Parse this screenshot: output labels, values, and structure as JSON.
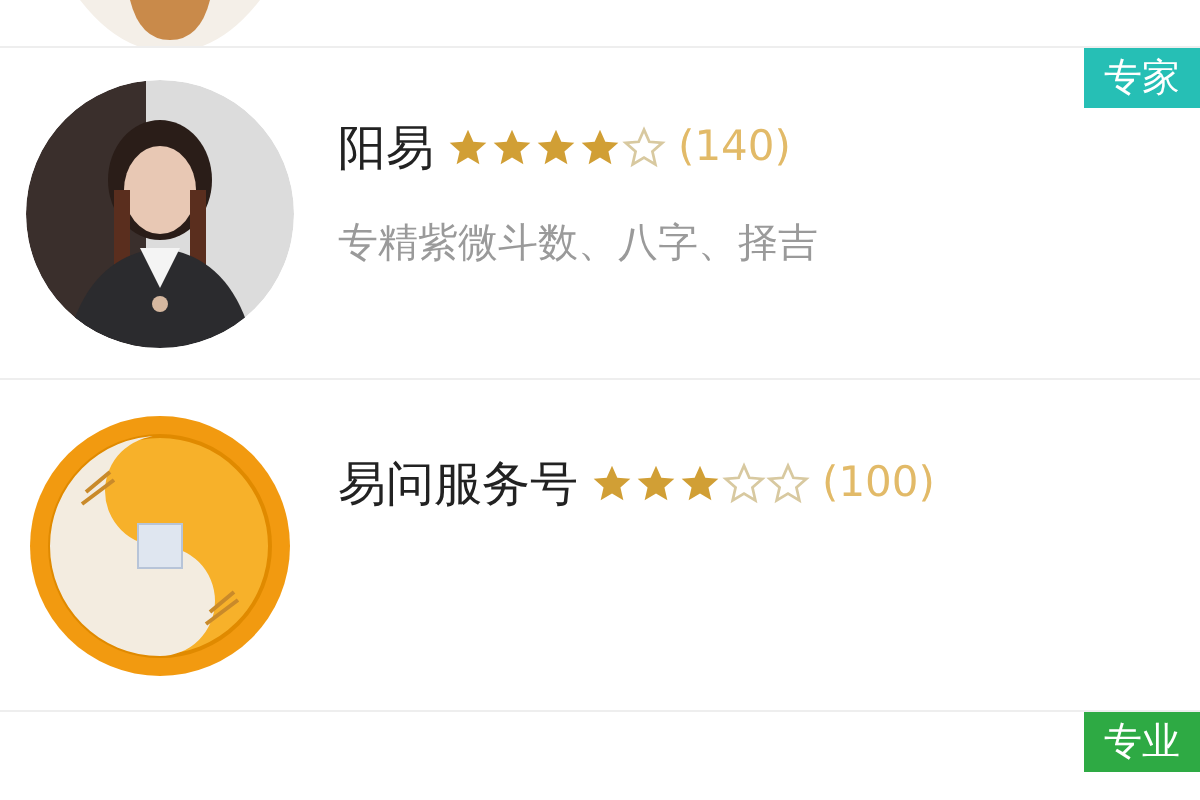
{
  "items": [
    {
      "name": "阳易",
      "stars": 4,
      "count": "(140)",
      "description": "专精紫微斗数、八字、择吉",
      "badge": {
        "text": "专家",
        "color": "#26bfb5"
      }
    },
    {
      "name": "易问服务号",
      "stars": 3,
      "count": "(100)",
      "avatar": {
        "kind": "logo"
      }
    }
  ],
  "bottom_item": {
    "badge": {
      "text": "专业",
      "color": "#2eaa44"
    }
  }
}
